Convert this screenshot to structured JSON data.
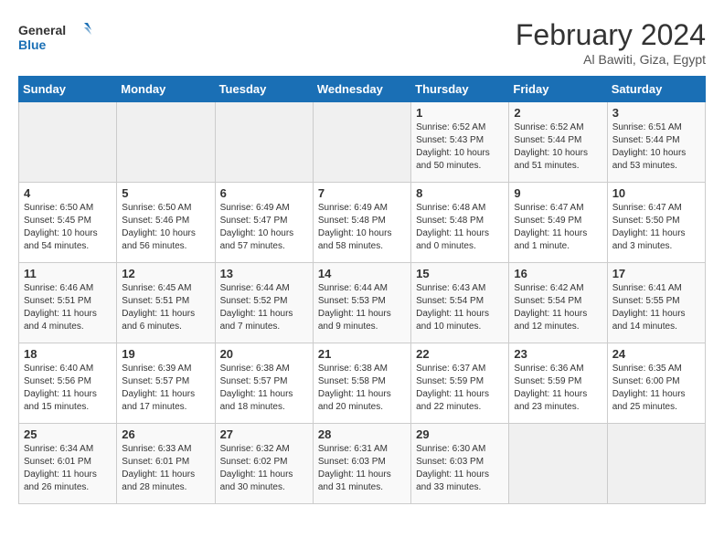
{
  "header": {
    "logo_general": "General",
    "logo_blue": "Blue",
    "month_year": "February 2024",
    "location": "Al Bawiti, Giza, Egypt"
  },
  "days_of_week": [
    "Sunday",
    "Monday",
    "Tuesday",
    "Wednesday",
    "Thursday",
    "Friday",
    "Saturday"
  ],
  "weeks": [
    [
      {
        "day": "",
        "info": ""
      },
      {
        "day": "",
        "info": ""
      },
      {
        "day": "",
        "info": ""
      },
      {
        "day": "",
        "info": ""
      },
      {
        "day": "1",
        "info": "Sunrise: 6:52 AM\nSunset: 5:43 PM\nDaylight: 10 hours and 50 minutes."
      },
      {
        "day": "2",
        "info": "Sunrise: 6:52 AM\nSunset: 5:44 PM\nDaylight: 10 hours and 51 minutes."
      },
      {
        "day": "3",
        "info": "Sunrise: 6:51 AM\nSunset: 5:44 PM\nDaylight: 10 hours and 53 minutes."
      }
    ],
    [
      {
        "day": "4",
        "info": "Sunrise: 6:50 AM\nSunset: 5:45 PM\nDaylight: 10 hours and 54 minutes."
      },
      {
        "day": "5",
        "info": "Sunrise: 6:50 AM\nSunset: 5:46 PM\nDaylight: 10 hours and 56 minutes."
      },
      {
        "day": "6",
        "info": "Sunrise: 6:49 AM\nSunset: 5:47 PM\nDaylight: 10 hours and 57 minutes."
      },
      {
        "day": "7",
        "info": "Sunrise: 6:49 AM\nSunset: 5:48 PM\nDaylight: 10 hours and 58 minutes."
      },
      {
        "day": "8",
        "info": "Sunrise: 6:48 AM\nSunset: 5:48 PM\nDaylight: 11 hours and 0 minutes."
      },
      {
        "day": "9",
        "info": "Sunrise: 6:47 AM\nSunset: 5:49 PM\nDaylight: 11 hours and 1 minute."
      },
      {
        "day": "10",
        "info": "Sunrise: 6:47 AM\nSunset: 5:50 PM\nDaylight: 11 hours and 3 minutes."
      }
    ],
    [
      {
        "day": "11",
        "info": "Sunrise: 6:46 AM\nSunset: 5:51 PM\nDaylight: 11 hours and 4 minutes."
      },
      {
        "day": "12",
        "info": "Sunrise: 6:45 AM\nSunset: 5:51 PM\nDaylight: 11 hours and 6 minutes."
      },
      {
        "day": "13",
        "info": "Sunrise: 6:44 AM\nSunset: 5:52 PM\nDaylight: 11 hours and 7 minutes."
      },
      {
        "day": "14",
        "info": "Sunrise: 6:44 AM\nSunset: 5:53 PM\nDaylight: 11 hours and 9 minutes."
      },
      {
        "day": "15",
        "info": "Sunrise: 6:43 AM\nSunset: 5:54 PM\nDaylight: 11 hours and 10 minutes."
      },
      {
        "day": "16",
        "info": "Sunrise: 6:42 AM\nSunset: 5:54 PM\nDaylight: 11 hours and 12 minutes."
      },
      {
        "day": "17",
        "info": "Sunrise: 6:41 AM\nSunset: 5:55 PM\nDaylight: 11 hours and 14 minutes."
      }
    ],
    [
      {
        "day": "18",
        "info": "Sunrise: 6:40 AM\nSunset: 5:56 PM\nDaylight: 11 hours and 15 minutes."
      },
      {
        "day": "19",
        "info": "Sunrise: 6:39 AM\nSunset: 5:57 PM\nDaylight: 11 hours and 17 minutes."
      },
      {
        "day": "20",
        "info": "Sunrise: 6:38 AM\nSunset: 5:57 PM\nDaylight: 11 hours and 18 minutes."
      },
      {
        "day": "21",
        "info": "Sunrise: 6:38 AM\nSunset: 5:58 PM\nDaylight: 11 hours and 20 minutes."
      },
      {
        "day": "22",
        "info": "Sunrise: 6:37 AM\nSunset: 5:59 PM\nDaylight: 11 hours and 22 minutes."
      },
      {
        "day": "23",
        "info": "Sunrise: 6:36 AM\nSunset: 5:59 PM\nDaylight: 11 hours and 23 minutes."
      },
      {
        "day": "24",
        "info": "Sunrise: 6:35 AM\nSunset: 6:00 PM\nDaylight: 11 hours and 25 minutes."
      }
    ],
    [
      {
        "day": "25",
        "info": "Sunrise: 6:34 AM\nSunset: 6:01 PM\nDaylight: 11 hours and 26 minutes."
      },
      {
        "day": "26",
        "info": "Sunrise: 6:33 AM\nSunset: 6:01 PM\nDaylight: 11 hours and 28 minutes."
      },
      {
        "day": "27",
        "info": "Sunrise: 6:32 AM\nSunset: 6:02 PM\nDaylight: 11 hours and 30 minutes."
      },
      {
        "day": "28",
        "info": "Sunrise: 6:31 AM\nSunset: 6:03 PM\nDaylight: 11 hours and 31 minutes."
      },
      {
        "day": "29",
        "info": "Sunrise: 6:30 AM\nSunset: 6:03 PM\nDaylight: 11 hours and 33 minutes."
      },
      {
        "day": "",
        "info": ""
      },
      {
        "day": "",
        "info": ""
      }
    ]
  ]
}
